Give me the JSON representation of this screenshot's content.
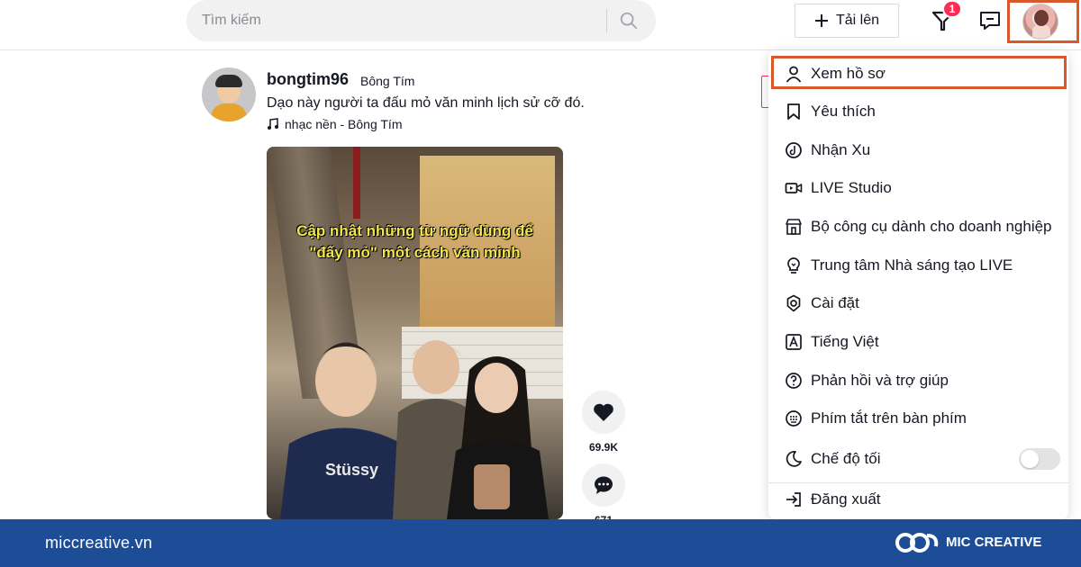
{
  "search": {
    "placeholder": "Tìm kiếm"
  },
  "header": {
    "upload_label": "Tải lên",
    "inbox_badge": "1"
  },
  "post": {
    "username": "bongtim96",
    "nickname": "Bông Tím",
    "caption": "Dạo này người ta đấu mỏ văn minh lịch sử cỡ đó.",
    "music": "nhạc nền - Bông Tím",
    "video_overlay_line1": "Cập nhật những từ ngữ dùng để",
    "video_overlay_line2": "\"đấy mỏ\" một cách văn minh",
    "like_count": "69.9K",
    "comment_count": "671"
  },
  "menu": {
    "items": [
      {
        "label": "Xem hồ sơ",
        "icon": "user-icon"
      },
      {
        "label": "Yêu thích",
        "icon": "bookmark-icon"
      },
      {
        "label": "Nhận Xu",
        "icon": "coin-icon"
      },
      {
        "label": "LIVE Studio",
        "icon": "video-camera-icon"
      },
      {
        "label": "Bộ công cụ dành cho doanh nghiệp",
        "icon": "store-icon"
      },
      {
        "label": "Trung tâm Nhà sáng tạo LIVE",
        "icon": "lightbulb-icon"
      },
      {
        "label": "Cài đặt",
        "icon": "gear-icon"
      },
      {
        "label": "Tiếng Việt",
        "icon": "language-icon"
      },
      {
        "label": "Phản hồi và trợ giúp",
        "icon": "help-icon"
      },
      {
        "label": "Phím tắt trên bàn phím",
        "icon": "keyboard-icon"
      },
      {
        "label": "Chế độ tối",
        "icon": "moon-icon"
      },
      {
        "label": "Đăng xuất",
        "icon": "logout-icon"
      }
    ],
    "dark_mode_on": false
  },
  "footer": {
    "site": "miccreative.vn",
    "brand": "MIC CREATIVE"
  },
  "colors": {
    "highlight": "#d9592a",
    "accent": "#fe2c55",
    "footer_bg": "#1d4d96"
  }
}
